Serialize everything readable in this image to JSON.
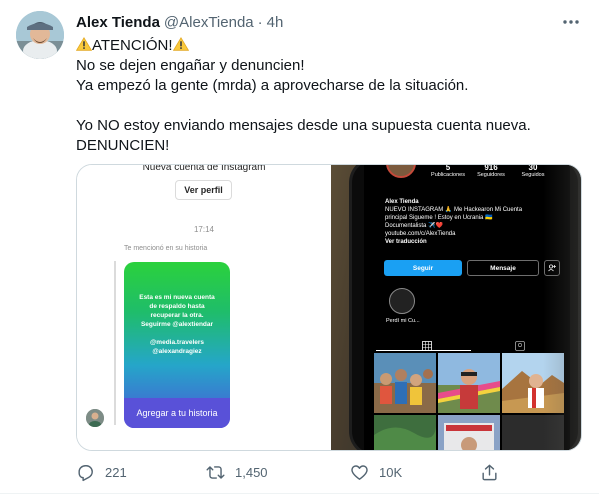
{
  "tweet": {
    "author_name": "Alex Tienda",
    "author_handle": "@AlexTienda",
    "separator": "·",
    "time": "4h",
    "lines": [
      "ATENCIÓN!",
      "No se dejen engañar y denuncien!",
      "Ya empezó la gente (mrda) a aprovecharse de la situación.",
      "",
      "Yo NO estoy enviando mensajes desde una supuesta cuenta nueva.",
      "DENUNCIEN!"
    ],
    "warning_icon": "warning-sign-emoji"
  },
  "dm_screenshot": {
    "header_title": "Nueva cuenta de Instagram",
    "view_profile_label": "Ver perfil",
    "timestamp": "17:14",
    "mention_text": "Te mencionó en su historia",
    "story_lines": [
      "Esta es mi nueva cuenta",
      "de respaldo hasta",
      "recuperar la otra.",
      "Seguirme @alextiendar",
      "",
      "@media.travelers",
      "@alexandragiez"
    ],
    "story_action_label": "Agregar a tu historia",
    "story_gradient": [
      "#2bd13c",
      "#25a6c9",
      "#4b56d6"
    ]
  },
  "phone_screenshot": {
    "stats": [
      {
        "value": "5",
        "label": "Publicaciones"
      },
      {
        "value": "916",
        "label": "Seguidores"
      },
      {
        "value": "30",
        "label": "Seguidos"
      }
    ],
    "bio_lines": [
      "Alex Tienda",
      "NUEVO INSTAGRAM 🙏 Me Hackearon Mi Cuenta",
      "principal Siguemе ! Estoy en Ucrania 🇺🇦",
      "Documentalista ✈️❤️",
      "youtube.com/c/AlexTienda",
      "Ver traducción"
    ],
    "follow_label": "Seguir",
    "message_label": "Mensaje",
    "highlight_label": "Perdí mi Cu...",
    "follow_color": "#1aa0f3"
  },
  "actions": {
    "replies": "221",
    "retweets": "1,450",
    "likes": "10K"
  },
  "colors": {
    "text_primary": "#0f1419",
    "text_secondary": "#536471",
    "border": "#cfd9de"
  }
}
